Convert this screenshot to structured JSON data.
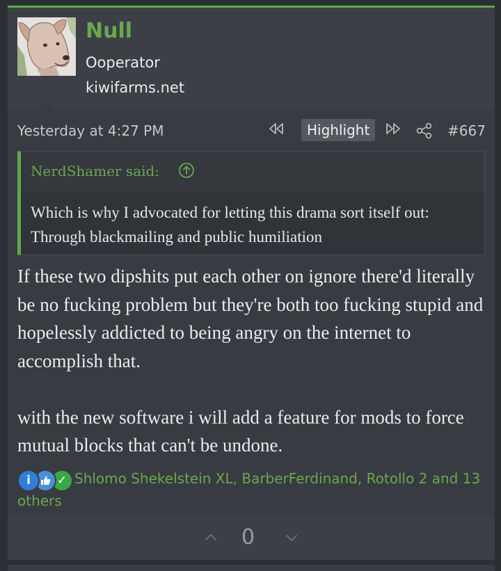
{
  "post": {
    "user": {
      "name": "Null",
      "title": "Ooperator",
      "banner": "kiwifarms.net",
      "avatar_icon": "dog-avatar"
    },
    "meta": {
      "date": "Yesterday at 4:27 PM",
      "highlight_label": "Highlight",
      "post_number": "#667"
    },
    "quote": {
      "author": "NerdShamer said:",
      "text": "Which is why I advocated for letting this drama sort itself out: Through blackmailing and public humiliation"
    },
    "message": {
      "paragraph1": "If these two dipshits put each other on ignore there'd literally be no fucking problem but they're both too fucking stupid and hopelessly addicted to being angry on the internet to accomplish that.",
      "paragraph2": "with the new software i will add a feature for mods to force mutual blocks that can't be undone."
    },
    "reactions": {
      "icons": [
        "informative-icon",
        "thumbs-up-icon",
        "agree-check-icon"
      ],
      "users_text": "Shlomo Shekelstein XL, BarberFerdinand, Rotollo 2 and 13 others"
    },
    "votes": {
      "count": "0"
    }
  },
  "colors": {
    "accent_green": "#69a84f",
    "post_bg": "#383b41",
    "page_bg": "#2b2e33",
    "info_blue": "#2f7fd8",
    "like_blue": "#4a90d9",
    "agree_green": "#39a845"
  }
}
